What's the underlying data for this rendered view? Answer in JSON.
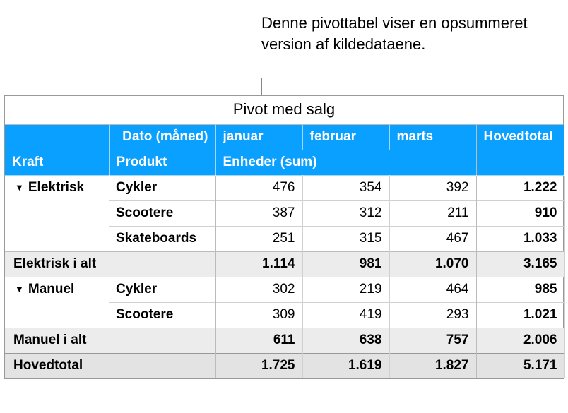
{
  "caption": "Denne pivottabel viser en opsummeret version af kildedataene.",
  "table": {
    "title": "Pivot med salg",
    "header1": {
      "date_label": "Dato (måned)",
      "months": [
        "januar",
        "februar",
        "marts"
      ],
      "grand_label": "Hovedtotal"
    },
    "header2": {
      "kraft": "Kraft",
      "produkt": "Produkt",
      "values_label": "Enheder (sum)"
    },
    "groups": [
      {
        "name": "Elektrisk",
        "rows": [
          {
            "produkt": "Cykler",
            "vals": [
              "476",
              "354",
              "392"
            ],
            "total": "1.222"
          },
          {
            "produkt": "Scootere",
            "vals": [
              "387",
              "312",
              "211"
            ],
            "total": "910"
          },
          {
            "produkt": "Skateboards",
            "vals": [
              "251",
              "315",
              "467"
            ],
            "total": "1.033"
          }
        ],
        "subtotal_label": "Elektrisk i alt",
        "subtotal": {
          "vals": [
            "1.114",
            "981",
            "1.070"
          ],
          "total": "3.165"
        }
      },
      {
        "name": "Manuel",
        "rows": [
          {
            "produkt": "Cykler",
            "vals": [
              "302",
              "219",
              "464"
            ],
            "total": "985"
          },
          {
            "produkt": "Scootere",
            "vals": [
              "309",
              "419",
              "293"
            ],
            "total": "1.021"
          }
        ],
        "subtotal_label": "Manuel i alt",
        "subtotal": {
          "vals": [
            "611",
            "638",
            "757"
          ],
          "total": "2.006"
        }
      }
    ],
    "grand": {
      "label": "Hovedtotal",
      "vals": [
        "1.725",
        "1.619",
        "1.827"
      ],
      "total": "5.171"
    }
  },
  "chart_data": {
    "type": "table",
    "title": "Pivot med salg",
    "row_dimensions": [
      "Kraft",
      "Produkt"
    ],
    "column_dimension": "Dato (måned)",
    "value_label": "Enheder (sum)",
    "columns": [
      "januar",
      "februar",
      "marts",
      "Hovedtotal"
    ],
    "rows": [
      {
        "Kraft": "Elektrisk",
        "Produkt": "Cykler",
        "januar": 476,
        "februar": 354,
        "marts": 392,
        "Hovedtotal": 1222
      },
      {
        "Kraft": "Elektrisk",
        "Produkt": "Scootere",
        "januar": 387,
        "februar": 312,
        "marts": 211,
        "Hovedtotal": 910
      },
      {
        "Kraft": "Elektrisk",
        "Produkt": "Skateboards",
        "januar": 251,
        "februar": 315,
        "marts": 467,
        "Hovedtotal": 1033
      },
      {
        "Kraft": "Elektrisk",
        "Produkt": "(i alt)",
        "januar": 1114,
        "februar": 981,
        "marts": 1070,
        "Hovedtotal": 3165
      },
      {
        "Kraft": "Manuel",
        "Produkt": "Cykler",
        "januar": 302,
        "februar": 219,
        "marts": 464,
        "Hovedtotal": 985
      },
      {
        "Kraft": "Manuel",
        "Produkt": "Scootere",
        "januar": 309,
        "februar": 419,
        "marts": 293,
        "Hovedtotal": 1021
      },
      {
        "Kraft": "Manuel",
        "Produkt": "(i alt)",
        "januar": 611,
        "februar": 638,
        "marts": 757,
        "Hovedtotal": 2006
      },
      {
        "Kraft": "(Hovedtotal)",
        "Produkt": "",
        "januar": 1725,
        "februar": 1619,
        "marts": 1827,
        "Hovedtotal": 5171
      }
    ]
  }
}
